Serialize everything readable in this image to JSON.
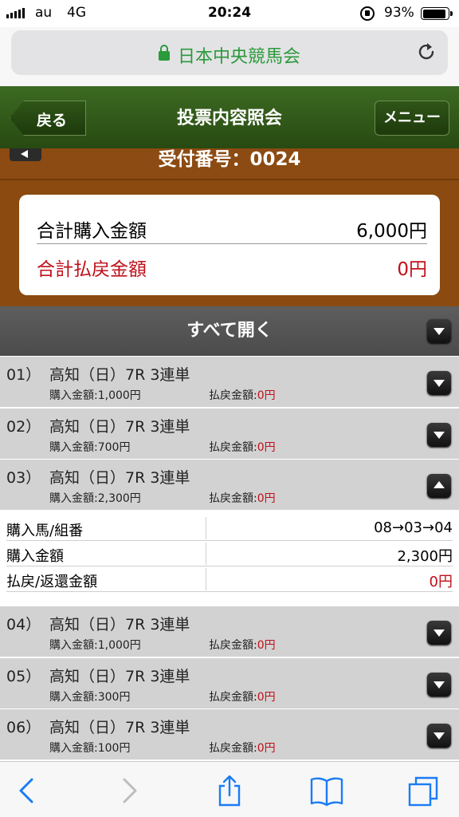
{
  "status_bar": {
    "carrier": "au",
    "network": "4G",
    "time": "20:24",
    "battery": "93%"
  },
  "browser": {
    "url": "日本中央競馬会"
  },
  "header": {
    "back_label": "戻る",
    "title": "投票内容照会",
    "menu_label": "メニュー"
  },
  "receipt": {
    "label": "受付番号：0024"
  },
  "summary": {
    "total_purchase_label": "合計購入金額",
    "total_purchase_value": "6,000円",
    "total_payout_label": "合計払戻金額",
    "total_payout_value": "0円"
  },
  "expand_all_label": "すべて開く",
  "entries": [
    {
      "num": "01）",
      "title": "高知（日）7R 3連単",
      "buy_label": "購入金額:",
      "buy": "1,000円",
      "pay_label": "払戻金額:",
      "pay": "0円"
    },
    {
      "num": "02）",
      "title": "高知（日）7R 3連単",
      "buy_label": "購入金額:",
      "buy": "700円",
      "pay_label": "払戻金額:",
      "pay": "0円"
    },
    {
      "num": "03）",
      "title": "高知（日）7R 3連単",
      "buy_label": "購入金額:",
      "buy": "2,300円",
      "pay_label": "払戻金額:",
      "pay": "0円"
    },
    {
      "num": "04）",
      "title": "高知（日）7R 3連単",
      "buy_label": "購入金額:",
      "buy": "1,000円",
      "pay_label": "払戻金額:",
      "pay": "0円"
    },
    {
      "num": "05）",
      "title": "高知（日）7R 3連単",
      "buy_label": "購入金額:",
      "buy": "300円",
      "pay_label": "払戻金額:",
      "pay": "0円"
    },
    {
      "num": "06）",
      "title": "高知（日）7R 3連単",
      "buy_label": "購入金額:",
      "buy": "100円",
      "pay_label": "払戻金額:",
      "pay": "0円"
    }
  ],
  "detail": {
    "rows": [
      {
        "label": "購入馬/組番",
        "value": "08→03→04"
      },
      {
        "label": "購入金額",
        "value": "2,300円"
      },
      {
        "label": "払戻/返還金額",
        "value": "0円"
      }
    ]
  },
  "toolbar": {
    "icons": [
      "back-icon",
      "forward-icon",
      "share-icon",
      "bookmarks-icon",
      "tabs-icon"
    ]
  }
}
